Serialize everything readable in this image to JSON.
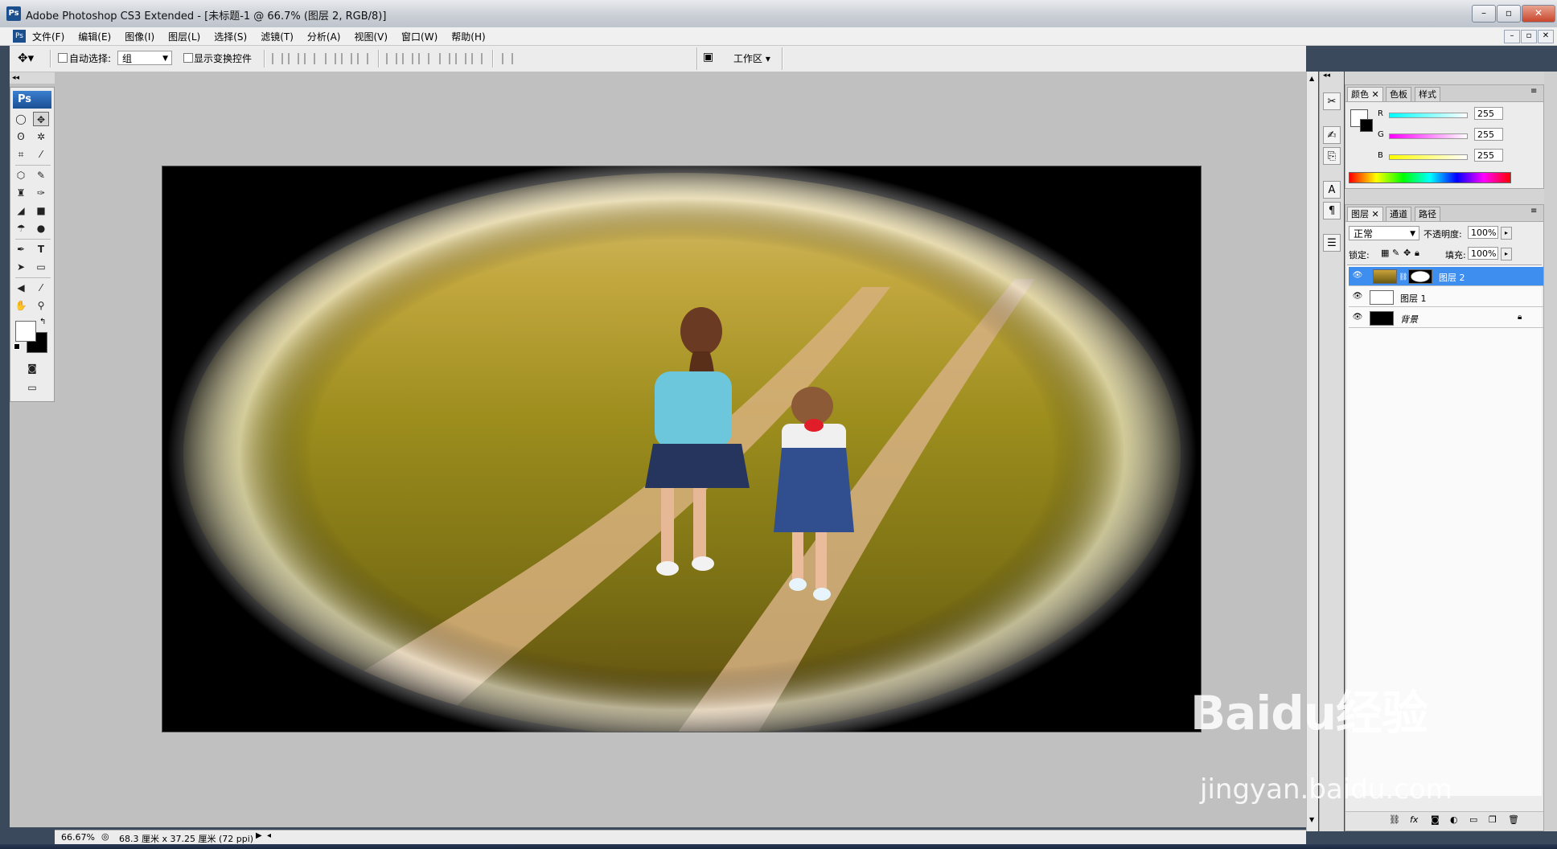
{
  "window": {
    "title": "Adobe Photoshop CS3 Extended - [未标题-1 @ 66.7% (图层 2, RGB/8)]",
    "app_icon": "Ps"
  },
  "menu": [
    "文件(F)",
    "编辑(E)",
    "图像(I)",
    "图层(L)",
    "选择(S)",
    "滤镜(T)",
    "分析(A)",
    "视图(V)",
    "窗口(W)",
    "帮助(H)"
  ],
  "options": {
    "auto_select_label": "自动选择:",
    "auto_select_value": "组",
    "show_transform_label": "显示变换控件",
    "workspace_label": "工作区"
  },
  "toolbox": {
    "logo": "Ps"
  },
  "status": {
    "zoom": "66.67%",
    "doc_size": "68.3 厘米 x 37.25 厘米 (72 ppi)"
  },
  "color_panel": {
    "tabs": [
      "颜色",
      "色板",
      "样式"
    ],
    "channels": [
      {
        "label": "R",
        "value": "255",
        "color": "#00c8d0"
      },
      {
        "label": "G",
        "value": "255",
        "color": "#e000e0"
      },
      {
        "label": "B",
        "value": "255",
        "color": "#e8e800"
      }
    ]
  },
  "layers_panel": {
    "tabs": [
      "图层",
      "通道",
      "路径"
    ],
    "blend_mode": "正常",
    "opacity_label": "不透明度:",
    "opacity_value": "100%",
    "lock_label": "锁定:",
    "fill_label": "填充:",
    "fill_value": "100%",
    "layers": [
      {
        "name": "图层 2",
        "active": true
      },
      {
        "name": "图层 1",
        "active": false
      },
      {
        "name": "背景",
        "active": false
      }
    ]
  },
  "watermark": {
    "brand": "Baidu经验",
    "url": "jingyan.baidu.com"
  }
}
